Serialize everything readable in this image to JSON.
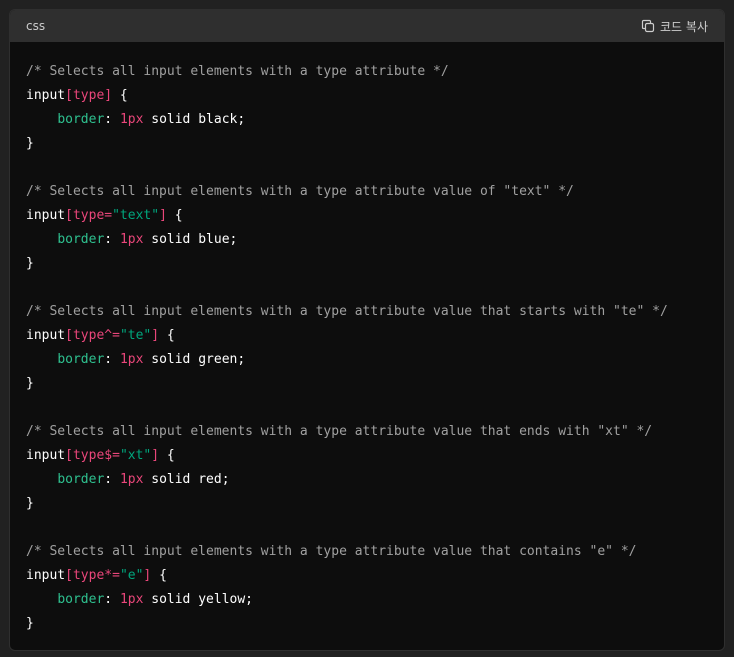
{
  "header": {
    "language": "css",
    "copy_label": "코드 복사",
    "copy_icon": "copy-icon"
  },
  "rules": [
    {
      "comment": "/* Selects all input elements with a type attribute */",
      "tag": "input",
      "attr_open": "[type",
      "operator": "",
      "value": "",
      "attr_close": "]",
      "brace_open": " {",
      "indent": "    ",
      "property": "border",
      "colon": ": ",
      "number": "1px",
      "rest": " solid black;",
      "brace_close": "}"
    },
    {
      "comment": "/* Selects all input elements with a type attribute value of \"text\" */",
      "tag": "input",
      "attr_open": "[type",
      "operator": "=",
      "value": "\"text\"",
      "attr_close": "]",
      "brace_open": " {",
      "indent": "    ",
      "property": "border",
      "colon": ": ",
      "number": "1px",
      "rest": " solid blue;",
      "brace_close": "}"
    },
    {
      "comment": "/* Selects all input elements with a type attribute value that starts with \"te\" */",
      "tag": "input",
      "attr_open": "[type",
      "operator": "^=",
      "value": "\"te\"",
      "attr_close": "]",
      "brace_open": " {",
      "indent": "    ",
      "property": "border",
      "colon": ": ",
      "number": "1px",
      "rest": " solid green;",
      "brace_close": "}"
    },
    {
      "comment": "/* Selects all input elements with a type attribute value that ends with \"xt\" */",
      "tag": "input",
      "attr_open": "[type",
      "operator": "$=",
      "value": "\"xt\"",
      "attr_close": "]",
      "brace_open": " {",
      "indent": "    ",
      "property": "border",
      "colon": ": ",
      "number": "1px",
      "rest": " solid red;",
      "brace_close": "}"
    },
    {
      "comment": "/* Selects all input elements with a type attribute value that contains \"e\" */",
      "tag": "input",
      "attr_open": "[type",
      "operator": "*=",
      "value": "\"e\"",
      "attr_close": "]",
      "brace_open": " {",
      "indent": "    ",
      "property": "border",
      "colon": ": ",
      "number": "1px",
      "rest": " solid yellow;",
      "brace_close": "}"
    }
  ]
}
